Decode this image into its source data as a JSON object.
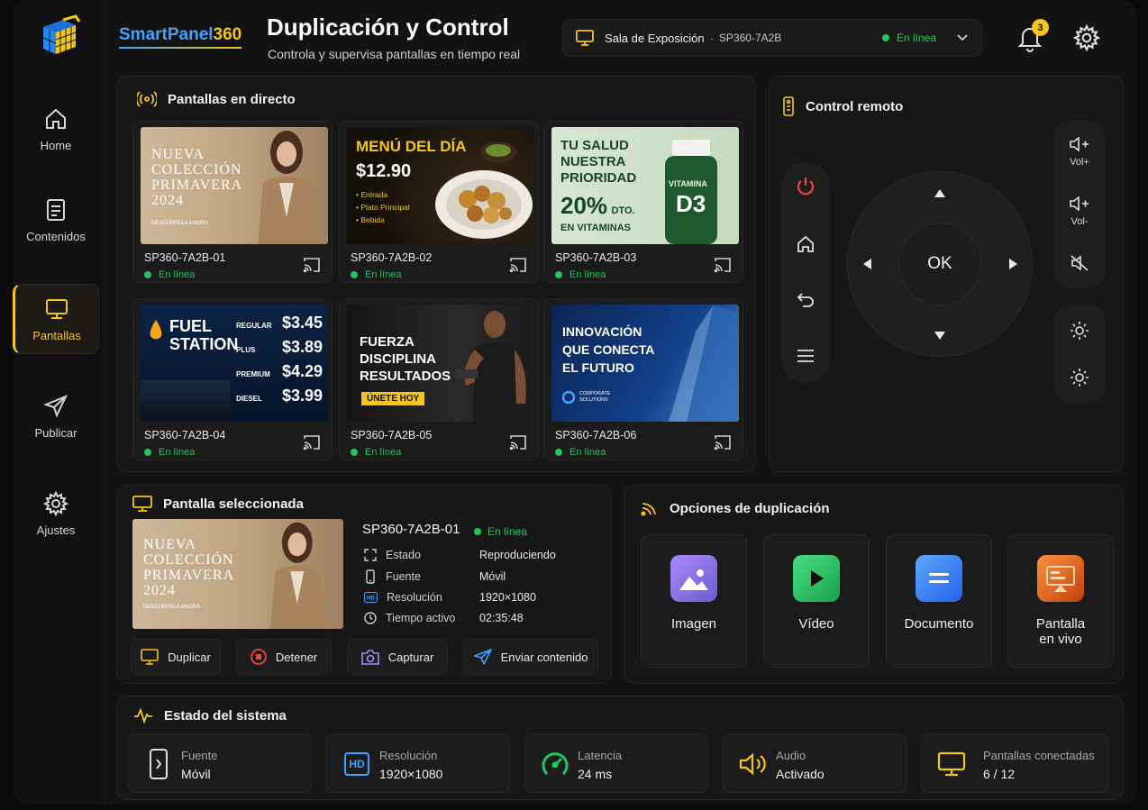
{
  "brand": {
    "name_a": "SmartPanel",
    "name_b": "360"
  },
  "header": {
    "title": "Duplicación y Control",
    "subtitle": "Controla y supervisa pantallas en tiempo real"
  },
  "device": {
    "name": "Sala de Exposición",
    "sep": "·",
    "code": "SP360-7A2B",
    "status": "En línea"
  },
  "notifications": {
    "count": "3"
  },
  "sidebar": {
    "items": [
      {
        "label": "Home"
      },
      {
        "label": "Contenidos"
      },
      {
        "label": "Pantallas"
      },
      {
        "label": "Publicar"
      },
      {
        "label": "Ajustes"
      }
    ]
  },
  "live": {
    "title": "Pantallas en directo",
    "screens": [
      {
        "id": "SP360-7A2B-01",
        "status": "En línea"
      },
      {
        "id": "SP360-7A2B-02",
        "status": "En línea"
      },
      {
        "id": "SP360-7A2B-03",
        "status": "En línea"
      },
      {
        "id": "SP360-7A2B-04",
        "status": "En línea"
      },
      {
        "id": "SP360-7A2B-05",
        "status": "En línea"
      },
      {
        "id": "SP360-7A2B-06",
        "status": "En línea"
      }
    ]
  },
  "ads": {
    "fashion": {
      "l1": "NUEVA",
      "l2": "COLECCIÓN",
      "l3": "PRIMAVERA",
      "l4": "2024",
      "cta": "DESCÚBRELA AHORA"
    },
    "menu": {
      "title": "MENÚ DEL DÍA",
      "price": "$12.90",
      "items": [
        "• Entrada",
        "• Plato Principal",
        "• Bebida"
      ]
    },
    "health": {
      "l1": "TU SALUD",
      "l2": "NUESTRA",
      "l3": "PRIORIDAD",
      "pct": "20%",
      "dto": "DTO.",
      "l4": "EN VITAMINAS",
      "bottle1": "VITAMINA",
      "bottle2": "D3"
    },
    "fuel": {
      "l1": "FUEL",
      "l2": "STATION",
      "prices": [
        {
          "k": "REGULAR",
          "v": "$3.45"
        },
        {
          "k": "PLUS",
          "v": "$3.89"
        },
        {
          "k": "PREMIUM",
          "v": "$4.29"
        },
        {
          "k": "DIESEL",
          "v": "$3.99"
        }
      ]
    },
    "gym": {
      "l1": "FUERZA",
      "l2": "DISCIPLINA",
      "l3": "RESULTADOS",
      "cta": "ÚNETE HOY"
    },
    "corp": {
      "l1": "INNOVACIÓN",
      "l2": "QUE CONECTA",
      "l3": "EL FUTURO",
      "brand1": "CORPORATE",
      "brand2": "SOLUTIONS"
    }
  },
  "remote": {
    "title": "Control remoto",
    "ok": "OK",
    "vol_up": "Vol+",
    "vol_down": "Vol-"
  },
  "selected": {
    "title": "Pantalla seleccionada",
    "id": "SP360-7A2B-01",
    "status": "En línea",
    "rows": [
      {
        "k": "Estado",
        "v": "Reproduciendo"
      },
      {
        "k": "Fuente",
        "v": "Móvil"
      },
      {
        "k": "Resolución",
        "v": "1920×1080"
      },
      {
        "k": "Tiempo activo",
        "v": "02:35:48"
      }
    ],
    "actions": [
      "Duplicar",
      "Detener",
      "Capturar",
      "Enviar contenido"
    ]
  },
  "options": {
    "title": "Opciones de duplicación",
    "items": [
      {
        "l": "Imagen"
      },
      {
        "l": "Vídeo"
      },
      {
        "l": "Documento"
      },
      {
        "l1": "Pantalla",
        "l2": "en vivo"
      }
    ]
  },
  "system": {
    "title": "Estado del sistema",
    "stats": [
      {
        "l": "Fuente",
        "v": "Móvil"
      },
      {
        "l": "Resolución",
        "v": "1920×1080",
        "badge": "HD"
      },
      {
        "l": "Latencia",
        "v": "24 ms"
      },
      {
        "l": "Audio",
        "v": "Activado"
      },
      {
        "l": "Pantallas conectadas",
        "v": "6 / 12"
      }
    ]
  },
  "colors": {
    "accent": "#f5c518",
    "brand_blue": "#3fa3ff",
    "online": "#22c55e",
    "danger": "#ef4444"
  }
}
